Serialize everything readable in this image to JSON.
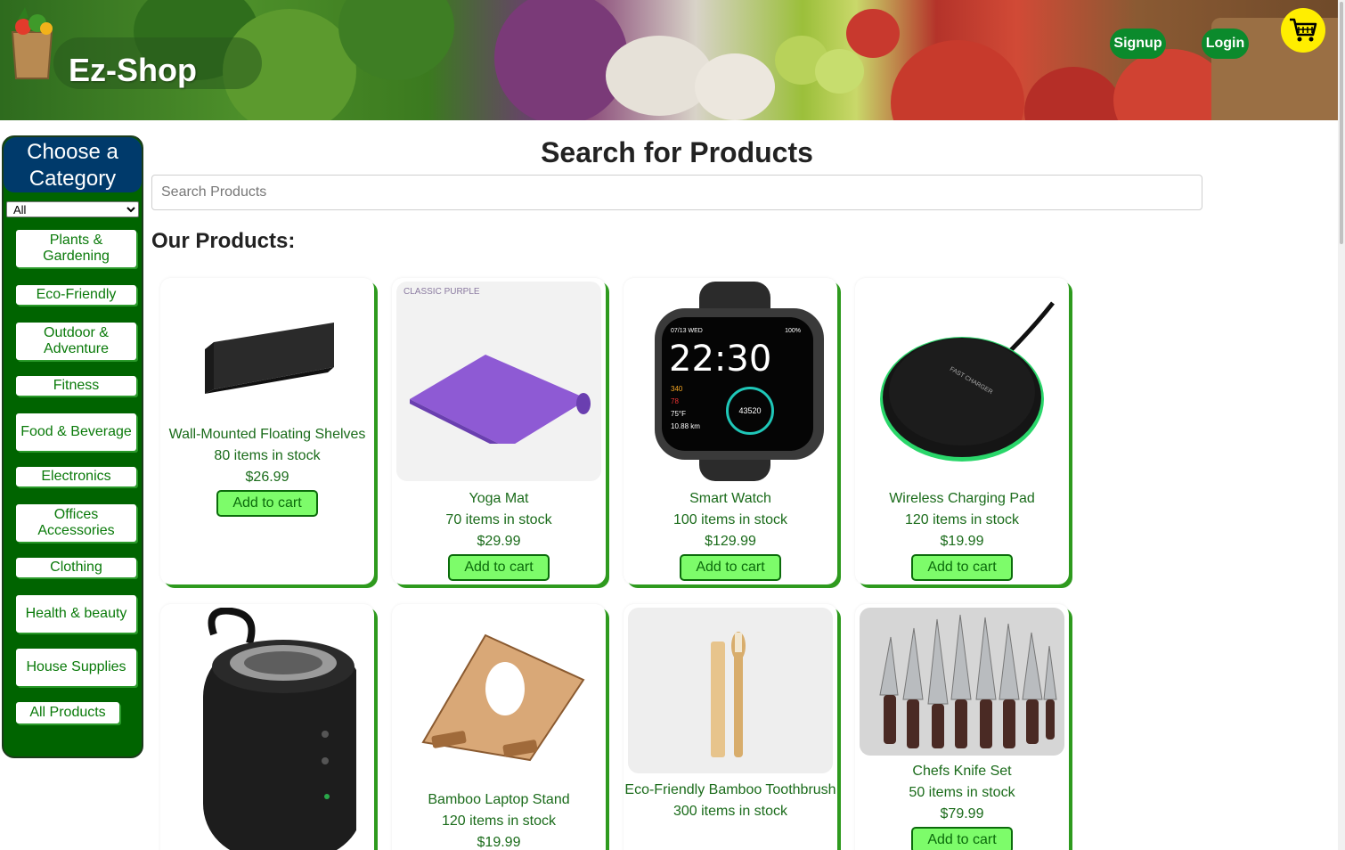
{
  "header": {
    "title": "Ez-Shop",
    "signup_label": "Signup",
    "login_label": "Login"
  },
  "sidebar": {
    "heading": "Choose a Category",
    "select_value": "All",
    "categories": [
      {
        "label": "Plants & Gardening"
      },
      {
        "label": "Eco-Friendly"
      },
      {
        "label": "Outdoor & Adventure"
      },
      {
        "label": "Fitness"
      },
      {
        "label": "Food & Beverage"
      },
      {
        "label": "Electronics"
      },
      {
        "label": "Offices Accessories"
      },
      {
        "label": "Clothing"
      },
      {
        "label": "Health & beauty"
      },
      {
        "label": "House Supplies"
      },
      {
        "label": "All Products"
      }
    ]
  },
  "main": {
    "title": "Search for Products",
    "search_placeholder": "Search Products",
    "products_heading": "Our Products:",
    "add_label": "Add to cart"
  },
  "products": [
    {
      "name": "Wall-Mounted Floating Shelves",
      "stock": "80 items in stock",
      "price": "$26.99",
      "icon": "shelf-image"
    },
    {
      "name": "Yoga Mat",
      "stock": "70 items in stock",
      "price": "$29.99",
      "icon": "yoga-mat-image",
      "image_caption": "CLASSIC PURPLE"
    },
    {
      "name": "Smart Watch",
      "stock": "100 items in stock",
      "price": "$129.99",
      "icon": "smart-watch-image",
      "watch_time": "22:30",
      "watch_date": "07/13 WED",
      "watch_battery": "100%",
      "watch_steps": "43520",
      "watch_kcal": "340",
      "watch_bpm": "78",
      "watch_temp": "75°F",
      "watch_dist": "10.88 km"
    },
    {
      "name": "Wireless Charging Pad",
      "stock": "120 items in stock",
      "price": "$19.99",
      "icon": "charging-pad-image",
      "pad_text": "FAST CHARGER"
    },
    {
      "name": "",
      "stock": "",
      "price": "",
      "icon": "speaker-image"
    },
    {
      "name": "Bamboo Laptop Stand",
      "stock": "120 items in stock",
      "price": "$19.99",
      "icon": "laptop-stand-image"
    },
    {
      "name": "Eco-Friendly Bamboo Toothbrush",
      "stock": "300 items in stock",
      "price": "",
      "icon": "toothbrush-image"
    },
    {
      "name": "Chefs Knife Set",
      "stock": "50 items in stock",
      "price": "$79.99",
      "icon": "knife-set-image"
    }
  ],
  "colors": {
    "sidebar_bg": "#006400",
    "sidebar_head_bg": "#003a6b",
    "accent_green": "#0b8a2c",
    "button_bg": "#7dfc6a",
    "cart_bg": "#ffee00"
  }
}
